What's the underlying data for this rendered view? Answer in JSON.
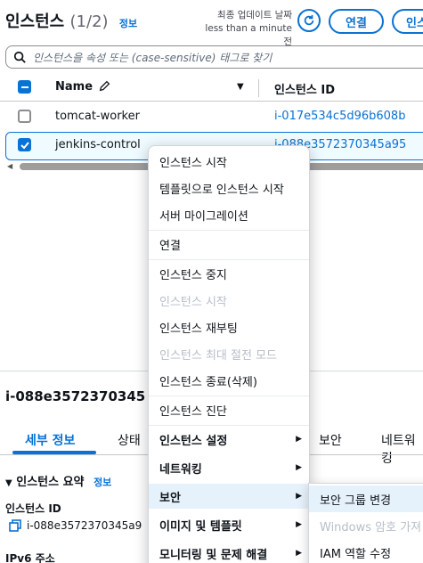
{
  "header": {
    "title": "인스턴스",
    "count": "(1/2)",
    "info_link": "정보",
    "updated_line1": "최종 업데이트 날짜",
    "updated_line2": "less than a minute 전",
    "connect_button": "연결",
    "state_button": "인스"
  },
  "search": {
    "placeholder": "인스턴스을 속성 또는 (case-sensitive) 태그로 찾기"
  },
  "table": {
    "columns": [
      "Name",
      "인스턴스 ID"
    ],
    "rows": [
      {
        "name": "tomcat-worker",
        "id": "i-017e534c5d96b608b",
        "selected": false
      },
      {
        "name": "jenkins-control",
        "id": "i-088e3572370345a95",
        "selected": true
      }
    ]
  },
  "context_menu": {
    "items": [
      {
        "label": "인스턴스 시작",
        "disabled": false
      },
      {
        "label": "템플릿으로 인스턴스 시작",
        "disabled": false
      },
      {
        "label": "서버 마이그레이션",
        "disabled": false
      },
      {
        "label": "연결",
        "disabled": false
      },
      {
        "label": "인스턴스 중지",
        "disabled": false
      },
      {
        "label": "인스턴스 시작",
        "disabled": true
      },
      {
        "label": "인스턴스 재부팅",
        "disabled": false
      },
      {
        "label": "인스턴스 최대 절전 모드",
        "disabled": true
      },
      {
        "label": "인스턴스 종료(삭제)",
        "disabled": false
      },
      {
        "label": "인스턴스 진단",
        "disabled": false
      },
      {
        "label": "인스턴스 설정",
        "submenu": true
      },
      {
        "label": "네트워킹",
        "submenu": true
      },
      {
        "label": "보안",
        "submenu": true,
        "active": true
      },
      {
        "label": "이미지 및 템플릿",
        "submenu": true
      },
      {
        "label": "모니터링 및 문제 해결",
        "submenu": true
      }
    ]
  },
  "submenu": {
    "items": [
      {
        "label": "보안 그룹 변경",
        "disabled": false
      },
      {
        "label": "Windows 암호 가져",
        "disabled": true
      },
      {
        "label": "IAM 역할 수정",
        "disabled": false
      }
    ]
  },
  "details": {
    "instance_id": "i-088e3572370345",
    "tabs": [
      "세부 정보",
      "상태",
      "보안",
      "네트워킹"
    ],
    "section_title": "인스턴스 요약",
    "section_info": "정보",
    "field_instance_id_label": "인스턴스 ID",
    "field_instance_id_value": "i-088e3572370345a9",
    "field_ipv6_label": "IPv6 주소"
  },
  "colors": {
    "accent": "#0972d3",
    "disabled": "#b6bec9"
  }
}
